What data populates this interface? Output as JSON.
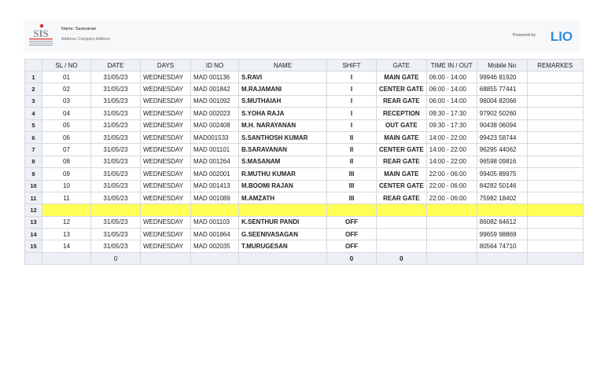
{
  "header": {
    "name_line": "Name: Saravanan",
    "address_line": "Address: Company Address",
    "powered_by": "Powered by",
    "lio_logo_text": "LIO",
    "company_logo_text": "SIS"
  },
  "colors": {
    "highlight_row": "#ffff55",
    "lio_blue": "#2f8fe0",
    "logo_red": "#d42a2a"
  },
  "table": {
    "columns": [
      "SL / NO",
      "DATE",
      "DAYS",
      "ID NO",
      "NAME",
      "SHIFT",
      "GATE",
      "TIME IN / OUT",
      "Mobile No",
      "REMARKES"
    ],
    "rows": [
      {
        "rn": "1",
        "sl": "01",
        "date": "31/05/23",
        "day": "WEDNESDAY",
        "id": "MAD 001136",
        "name": "S.RAVI",
        "shift": "I",
        "gate": "MAIN GATE",
        "time": "06:00 - 14:00",
        "mobile": "99946 81920",
        "remarks": ""
      },
      {
        "rn": "2",
        "sl": "02",
        "date": "31/05/23",
        "day": "WEDNESDAY",
        "id": "MAD 001842",
        "name": "M.RAJAMANI",
        "shift": "I",
        "gate": "CENTER GATE",
        "time": "06:00 - 14:00",
        "mobile": "68855 77441",
        "remarks": ""
      },
      {
        "rn": "3",
        "sl": "03",
        "date": "31/05/23",
        "day": "WEDNESDAY",
        "id": "MAD 001092",
        "name": "S.MUTHAIAH",
        "shift": "I",
        "gate": "REAR GATE",
        "time": "06:00 - 14:00",
        "mobile": "96004 82066",
        "remarks": ""
      },
      {
        "rn": "4",
        "sl": "04",
        "date": "31/05/23",
        "day": "WEDNESDAY",
        "id": "MAD 002023",
        "name": "S.YOHA RAJA",
        "shift": "I",
        "gate": "RECEPTION",
        "time": "09:30 - 17:30",
        "mobile": "97902 50260",
        "remarks": ""
      },
      {
        "rn": "5",
        "sl": "05",
        "date": "31/05/23",
        "day": "WEDNESDAY",
        "id": "MAD 002408",
        "name": "M.H. NARAYANAN",
        "shift": "I",
        "gate": "OUT GATE",
        "time": "09:30 - 17:30",
        "mobile": "90438 06094",
        "remarks": ""
      },
      {
        "rn": "6",
        "sl": "06",
        "date": "31/05/23",
        "day": "WEDNESDAY",
        "id": "MAD001533",
        "name": "S.SANTHOSH KUMAR",
        "shift": "II",
        "gate": "MAIN GATE",
        "time": "14:00 - 22:00",
        "mobile": "99423 58744",
        "remarks": ""
      },
      {
        "rn": "7",
        "sl": "07",
        "date": "31/05/23",
        "day": "WEDNESDAY",
        "id": "MAD 001101",
        "name": "B.SARAVANAN",
        "shift": "II",
        "gate": "CENTER GATE",
        "time": "14:00 - 22:00",
        "mobile": "96295 44062",
        "remarks": ""
      },
      {
        "rn": "8",
        "sl": "08",
        "date": "31/05/23",
        "day": "WEDNESDAY",
        "id": "MAD 001264",
        "name": "S.MASANAM",
        "shift": "II",
        "gate": "REAR GATE",
        "time": "14:00 - 22:00",
        "mobile": "96598 09816",
        "remarks": ""
      },
      {
        "rn": "9",
        "sl": "09",
        "date": "31/05/23",
        "day": "WEDNESDAY",
        "id": "MAD 002001",
        "name": "R.MUTHU KUMAR",
        "shift": "III",
        "gate": "MAIN GATE",
        "time": "22:00 - 06:00",
        "mobile": "99405 89975",
        "remarks": ""
      },
      {
        "rn": "10",
        "sl": "10",
        "date": "31/05/23",
        "day": "WEDNESDAY",
        "id": "MAD 001413",
        "name": "M.BOOMI RAJAN",
        "shift": "III",
        "gate": "CENTER GATE",
        "time": "22:00 - 06:00",
        "mobile": "84282 50146",
        "remarks": ""
      },
      {
        "rn": "11",
        "sl": "11",
        "date": "31/05/23",
        "day": "WEDNESDAY",
        "id": "MAD 001089",
        "name": "M.AMZATH",
        "shift": "III",
        "gate": "REAR GATE",
        "time": "22:00 - 06:00",
        "mobile": "75982 18402",
        "remarks": ""
      },
      {
        "rn": "12",
        "sl": "",
        "date": "",
        "day": "",
        "id": "",
        "name": "",
        "shift": "",
        "gate": "",
        "time": "",
        "mobile": "",
        "remarks": "",
        "highlight": true
      },
      {
        "rn": "13",
        "sl": "12",
        "date": "31/05/23",
        "day": "WEDNESDAY",
        "id": "MAD 001103",
        "name": "K.SENTHUR PANDI",
        "shift": "OFF",
        "gate": "",
        "time": "",
        "mobile": "86082 64612",
        "remarks": ""
      },
      {
        "rn": "14",
        "sl": "13",
        "date": "31/05/23",
        "day": "WEDNESDAY",
        "id": "MAD 001864",
        "name": "G.SEENIVASAGAN",
        "shift": "OFF",
        "gate": "",
        "time": "",
        "mobile": "99659 98869",
        "remarks": ""
      },
      {
        "rn": "15",
        "sl": "14",
        "date": "31/05/23",
        "day": "WEDNESDAY",
        "id": "MAD 002035",
        "name": "T.MURUGESAN",
        "shift": "OFF",
        "gate": "",
        "time": "",
        "mobile": "80564 74710",
        "remarks": ""
      }
    ],
    "totals": {
      "rn": "",
      "sl": "",
      "date": "0",
      "day": "",
      "id": "",
      "name": "",
      "shift": "0",
      "gate": "0",
      "time": "",
      "mobile": "",
      "remarks": ""
    }
  }
}
